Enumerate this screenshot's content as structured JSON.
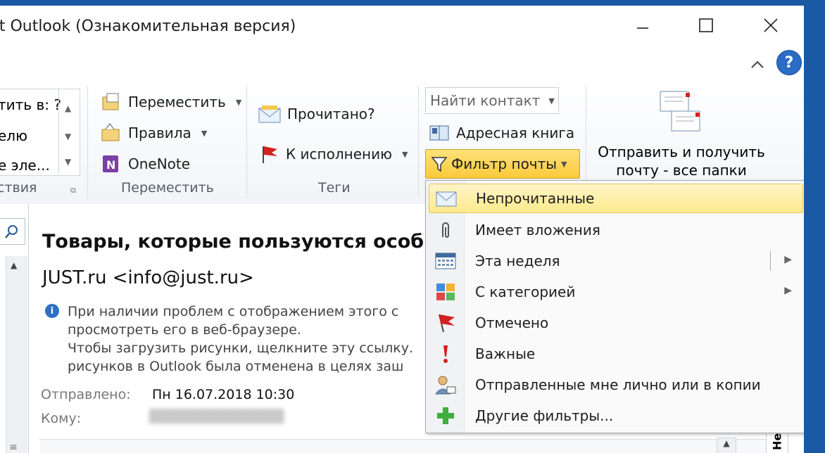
{
  "window": {
    "title": "oft Outlook (Ознакомительная версия)",
    "minimize_label": "—",
    "maximize_label": "☐",
    "close_label": "✕"
  },
  "ribbon": {
    "partial_group": {
      "row1": "тить в: ?",
      "row2": "елю",
      "row3": "е эле...",
      "label": "ствия"
    },
    "move_group": {
      "move_button": "Переместить",
      "rules_button": "Правила",
      "onenote_button": "OneNote",
      "label": "Переместить"
    },
    "tags_group": {
      "read_button": "Прочитано?",
      "followup_button": "К исполнению",
      "label": "Теги"
    },
    "find_group": {
      "find_contact_placeholder": "Найти контакт",
      "address_book_button": "Адресная книга",
      "filter_mail_button": "Фильтр почты"
    },
    "send_receive": {
      "line1": "Отправить и получить",
      "line2": "почту - все папки"
    }
  },
  "message": {
    "subject": "Товары, которые пользуются особ",
    "sender": "JUST.ru <info@just.ru>",
    "info_lines": [
      "При наличии проблем с отображением этого с",
      "просмотреть его в веб-браузере.",
      "Чтобы загрузить рисунки, щелкните эту ссылку.",
      "рисунков в Outlook была отменена в целях заш"
    ],
    "sent_label": "Отправлено:",
    "sent_value": "Пн 16.07.2018 10:30",
    "to_label": "Кому:",
    "to_value": "████████████████"
  },
  "filter_menu": {
    "items": [
      {
        "label": "Непрочитанные",
        "icon": "envelope-icon"
      },
      {
        "label": "Имеет вложения",
        "icon": "paperclip-icon"
      },
      {
        "label": "Эта неделя",
        "icon": "calendar-icon"
      },
      {
        "label": "С категорией",
        "icon": "category-icon"
      },
      {
        "label": "Отмечено",
        "icon": "red-flag-icon"
      },
      {
        "label": "Важные",
        "icon": "exclamation-icon"
      },
      {
        "label": "Отправленные мне лично или в копии",
        "icon": "person-icon"
      },
      {
        "label": "Другие фильтры...",
        "icon": "green-plus-icon"
      }
    ]
  },
  "right_edge_text": "Не",
  "colors": {
    "accent_highlight": "#fde98c",
    "flag_red": "#d32020",
    "help_blue": "#2b6cc4"
  }
}
